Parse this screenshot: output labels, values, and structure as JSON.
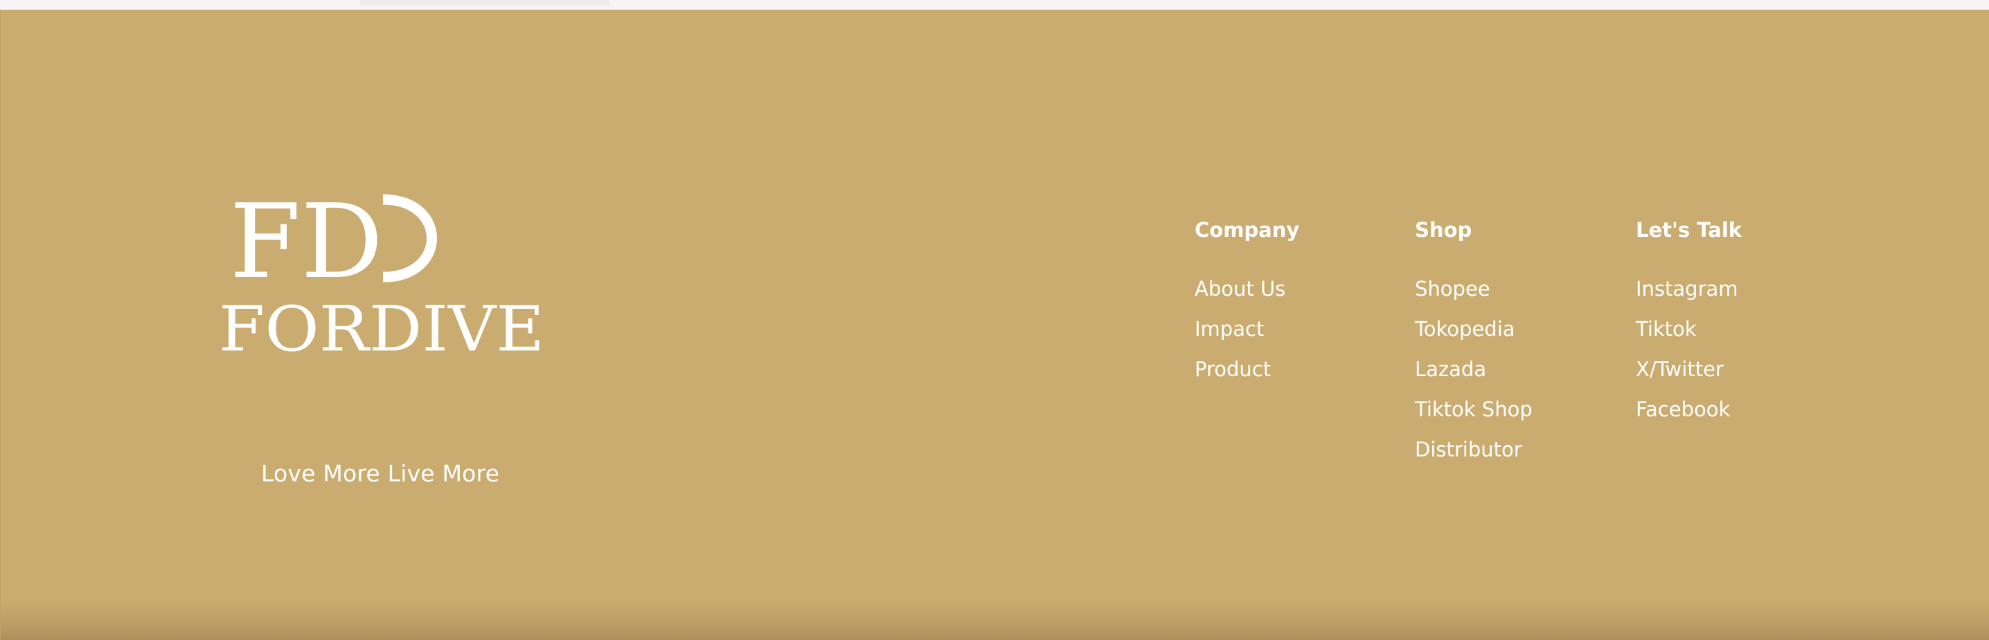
{
  "brand": {
    "monogram": "FD",
    "name": "FORDIVE",
    "tagline": "Love More Live More"
  },
  "columns": [
    {
      "heading": "Company",
      "links": [
        "About Us",
        "Impact",
        "Product"
      ]
    },
    {
      "heading": "Shop",
      "links": [
        "Shopee",
        "Tokopedia",
        "Lazada",
        "Tiktok Shop",
        "Distributor"
      ]
    },
    {
      "heading": "Let's Talk",
      "links": [
        "Instagram",
        "Tiktok",
        "X/Twitter",
        "Facebook"
      ]
    }
  ],
  "colors": {
    "footer_background": "#cbac70",
    "text": "#ffffff"
  }
}
